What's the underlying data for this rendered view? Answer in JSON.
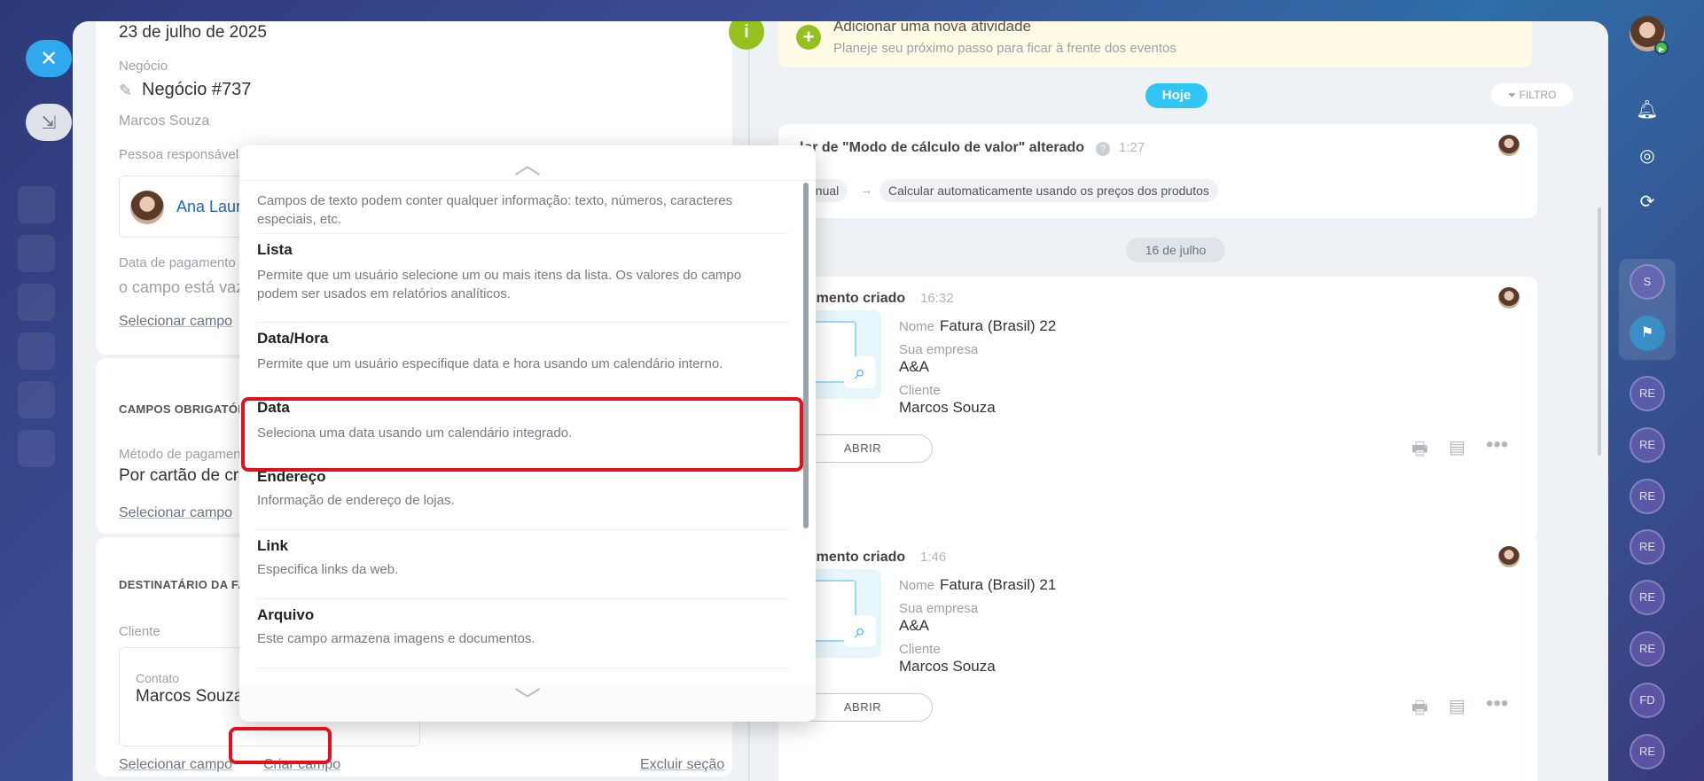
{
  "left": {
    "date_value": "23 de julho de 2025",
    "deal_label": "Negócio",
    "deal_value": "Negócio #737",
    "owner_name": "Marcos Souza",
    "responsible_label": "Pessoa responsável",
    "responsible_name": "Ana Laura",
    "payment_date_label": "Data de pagamento d",
    "empty_field": "o campo está vaz",
    "select_field": "Selecionar campo",
    "required_section_title": "CAMPOS OBRIGATÓRIO",
    "payment_method_label": "Método de pagament",
    "payment_method_value": "Por cartão de créd",
    "recipient_section_title": "DESTINATÁRIO DA FAT",
    "client_label": "Cliente",
    "contact_label": "Contato",
    "contact_name": "Marcos Souza",
    "create_field": "Criar campo",
    "delete_section": "Excluir seção"
  },
  "popup": {
    "intro_desc": "Campos de texto podem conter qualquer informação: texto, números, caracteres especiais, etc.",
    "options": [
      {
        "name": "Lista",
        "desc": "Permite que um usuário selecione um ou mais itens da lista. Os valores do campo podem ser usados em relatórios analíticos."
      },
      {
        "name": "Data/Hora",
        "desc": "Permite que um usuário especifique data e hora usando um calendário interno."
      },
      {
        "name": "Data",
        "desc": "Seleciona uma data usando um calendário integrado."
      },
      {
        "name": "Endereço",
        "desc": "Informação de endereço de lojas."
      },
      {
        "name": "Link",
        "desc": "Especifica links da web."
      },
      {
        "name": "Arquivo",
        "desc": "Este campo armazena imagens e documentos."
      }
    ]
  },
  "timeline": {
    "info_icon_text": "i",
    "add_activity_title": "Adicionar uma nova atividade",
    "add_activity_hint": "Planeje seu próximo passo para ficar à frente dos eventos",
    "today": "Hoje",
    "filter": "FILTRO",
    "change_title": "lor de \"Modo de cálculo de valor\" alterado",
    "change_time": "1:27",
    "change_from": "anual",
    "change_arrow": "→",
    "change_to": "Calcular automaticamente usando os preços dos produtos",
    "date_divider": "16 de julho",
    "docs": [
      {
        "title": "cumento criado",
        "time": "16:32",
        "name_label": "Nome",
        "name": "Fatura (Brasil) 22",
        "company_label": "Sua empresa",
        "company": "A&A",
        "client_label": "Cliente",
        "client": "Marcos Souza",
        "open": "ABRIR"
      },
      {
        "title": "cumento criado",
        "time": "1:46",
        "name_label": "Nome",
        "name": "Fatura (Brasil) 21",
        "company_label": "Sua empresa",
        "company": "A&A",
        "client_label": "Cliente",
        "client": "Marcos Souza",
        "open": "ABRIR"
      }
    ]
  },
  "sidebar": {
    "chats": [
      "S",
      "RE",
      "RE",
      "RE",
      "RE",
      "RE",
      "RE",
      "FD",
      "RE"
    ]
  },
  "colors": {
    "accent": "#2fc6f6",
    "highlight_red": "#e3101b",
    "activity_green": "#95c11f"
  }
}
